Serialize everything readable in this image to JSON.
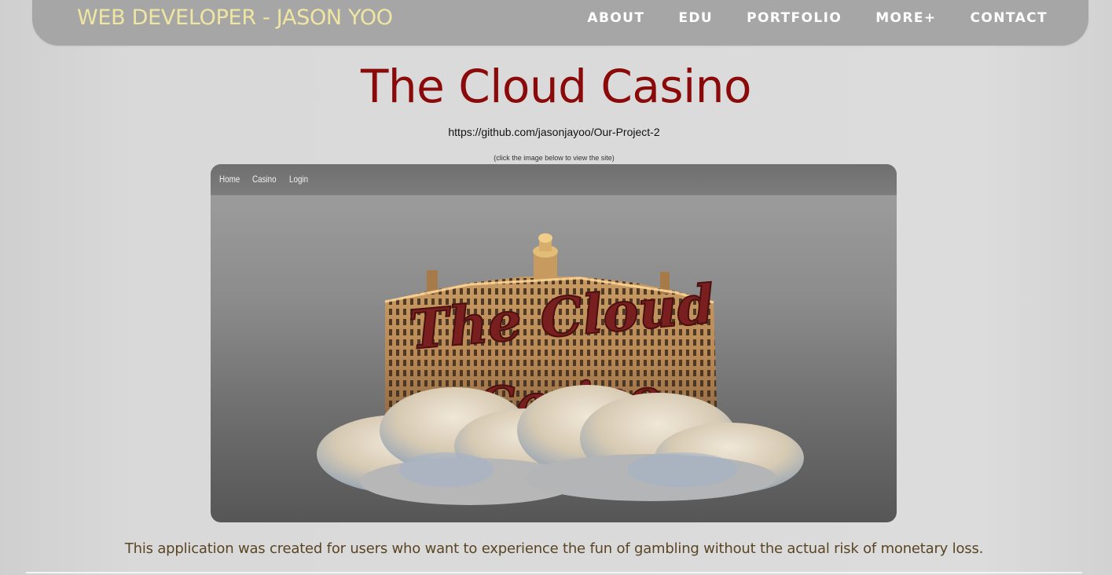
{
  "navbar": {
    "brand": "WEB DEVELOPER - JASON YOO",
    "links": [
      {
        "label": "ABOUT"
      },
      {
        "label": "EDU"
      },
      {
        "label": "PORTFOLIO"
      },
      {
        "label": "MORE+"
      },
      {
        "label": "CONTACT"
      }
    ]
  },
  "project": {
    "title": "The Cloud Casino",
    "repo_url": "https://github.com/jasonjayoo/Our-Project-2",
    "hint": "(click the image below to view the site)",
    "description": "This application was created for users who want to experience the fun of gambling without the actual risk of monetary loss."
  },
  "preview": {
    "nav_links": [
      "Home",
      "Casino",
      "Login"
    ],
    "logo_line1": "The Cloud",
    "logo_line2": "Casino"
  },
  "colors": {
    "brand": "#efe6a1",
    "title": "#8a0a0a",
    "description": "#5a4525",
    "navbar_bg": "#a6a6a6"
  }
}
